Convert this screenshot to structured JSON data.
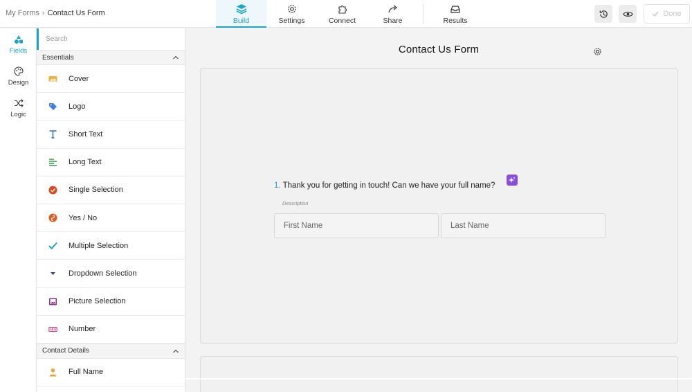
{
  "breadcrumb": {
    "parent": "My Forms",
    "separator": "›",
    "current": "Contact Us Form"
  },
  "tabs": [
    {
      "label": "Build",
      "icon": "layers-icon",
      "active": true
    },
    {
      "label": "Settings",
      "icon": "gear-icon"
    },
    {
      "label": "Connect",
      "icon": "puzzle-icon"
    },
    {
      "label": "Share",
      "icon": "share-arrow-icon"
    },
    {
      "label": "Results",
      "icon": "inbox-icon"
    }
  ],
  "toolbar": {
    "done_label": "Done"
  },
  "rail": [
    {
      "label": "Fields",
      "icon": "fields-icon",
      "active": true
    },
    {
      "label": "Design",
      "icon": "palette-icon"
    },
    {
      "label": "Logic",
      "icon": "shuffle-icon"
    }
  ],
  "panel": {
    "search_placeholder": "Search",
    "sections": [
      {
        "title": "Essentials",
        "fields": [
          {
            "label": "Cover",
            "icon": "cover-icon"
          },
          {
            "label": "Logo",
            "icon": "tag-icon"
          },
          {
            "label": "Short Text",
            "icon": "text-t-icon"
          },
          {
            "label": "Long Text",
            "icon": "paragraph-icon"
          },
          {
            "label": "Single Selection",
            "icon": "check-circle-icon"
          },
          {
            "label": "Yes / No",
            "icon": "yes-no-icon"
          },
          {
            "label": "Multiple Selection",
            "icon": "checkmark-icon"
          },
          {
            "label": "Dropdown Selection",
            "icon": "triangle-down-icon"
          },
          {
            "label": "Picture Selection",
            "icon": "picture-icon"
          },
          {
            "label": "Number",
            "icon": "number-icon"
          }
        ]
      },
      {
        "title": "Contact Details",
        "fields": [
          {
            "label": "Full Name",
            "icon": "person-icon"
          }
        ]
      }
    ]
  },
  "canvas": {
    "form_title": "Contact Us Form",
    "question": {
      "number": "1.",
      "text": "Thank you for getting in touch! Can we have your full name?",
      "description": "Description"
    },
    "inputs": {
      "first_placeholder": "First Name",
      "last_placeholder": "Last Name"
    }
  },
  "colors": {
    "accent": "#1aa5cf",
    "ai_badge": "#8a4fd8"
  }
}
